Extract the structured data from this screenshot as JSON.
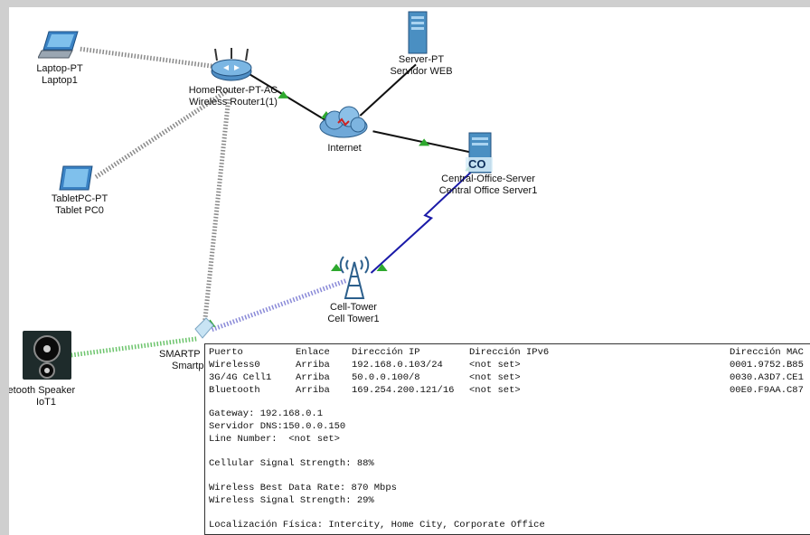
{
  "devices": {
    "laptop": {
      "line1": "Laptop-PT",
      "line2": "Laptop1",
      "icon": "laptop-icon"
    },
    "router": {
      "line1": "HomeRouter-PT-AC",
      "line2": "Wireless Router1(1)",
      "icon": "wireless-router-icon"
    },
    "server": {
      "line1": "Server-PT",
      "line2": "Servidor WEB",
      "icon": "server-icon"
    },
    "internet": {
      "line1": "Internet",
      "icon": "cloud-icon"
    },
    "central_office": {
      "line1": "Central-Office-Server",
      "line2": "Central Office Server1",
      "badge": "CO",
      "icon": "central-office-server-icon"
    },
    "tablet": {
      "line1": "TabletPC-PT",
      "line2": "Tablet PC0",
      "icon": "tablet-icon"
    },
    "cell_tower": {
      "line1": "Cell-Tower",
      "line2": "Cell Tower1",
      "icon": "cell-tower-icon"
    },
    "speaker": {
      "line1": "luetooth Speaker",
      "line2": "IoT1",
      "icon": "speaker-icon"
    },
    "smartphone": {
      "line1": "SMARTP",
      "line2": "Smartp",
      "icon": "smartphone-icon"
    }
  },
  "info_panel": {
    "headers": {
      "port": "Puerto",
      "link": "Enlace",
      "ip": "Dirección IP",
      "ipv6": "Dirección IPv6",
      "mac": "Dirección MAC"
    },
    "rows": [
      {
        "port": "Wireless0",
        "link": "Arriba",
        "ip": "192.168.0.103/24",
        "ipv6": "<not set>",
        "mac": "0001.9752.B85"
      },
      {
        "port": "3G/4G Cell1",
        "link": "Arriba",
        "ip": "50.0.0.100/8",
        "ipv6": "<not set>",
        "mac": "0030.A3D7.CE1"
      },
      {
        "port": "Bluetooth",
        "link": "Arriba",
        "ip": "169.254.200.121/16",
        "ipv6": "<not set>",
        "mac": "00E0.F9AA.C87"
      }
    ],
    "gateway": "Gateway: 192.168.0.1",
    "dns": "Servidor DNS:150.0.0.150",
    "line_number": "Line Number:  <not set>",
    "cellular": "Cellular Signal Strength: 88%",
    "best_rate": "Wireless Best Data Rate: 870 Mbps",
    "signal": "Wireless Signal Strength: 29%",
    "location": "Localización Física: Intercity, Home City, Corporate Office"
  },
  "colors": {
    "ethernet": "#111111",
    "coax": "#1a1aa8",
    "wireless": "#9a9a9a",
    "bluetooth_wireless": "#8a8ad8",
    "iot_wireless": "#6cc46c",
    "link_up": "#2ea82e"
  }
}
